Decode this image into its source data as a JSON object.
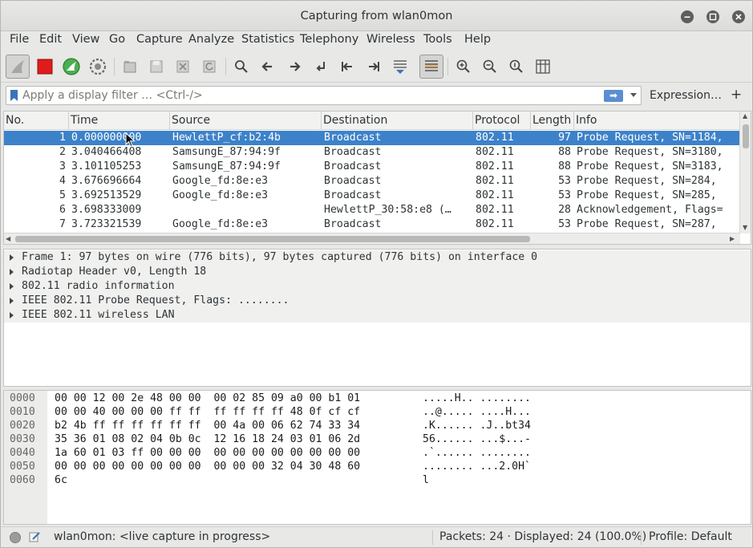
{
  "window": {
    "title": "Capturing from wlan0mon",
    "minimize_icon": "minimize-icon",
    "maximize_icon": "maximize-icon",
    "close_icon": "close-icon"
  },
  "menu": [
    "File",
    "Edit",
    "View",
    "Go",
    "Capture",
    "Analyze",
    "Statistics",
    "Telephony",
    "Wireless",
    "Tools",
    "Help"
  ],
  "toolbar": {
    "icons": [
      "shark-fin-start-icon",
      "stop-capture-icon",
      "restart-capture-icon",
      "capture-options-icon",
      "open-file-icon",
      "save-file-icon",
      "close-file-icon",
      "reload-file-icon",
      "find-packet-icon",
      "go-back-icon",
      "go-forward-icon",
      "go-to-packet-icon",
      "first-packet-icon",
      "last-packet-icon",
      "autoscroll-icon",
      "colorize-icon",
      "zoom-in-icon",
      "zoom-out-icon",
      "normal-size-icon",
      "resize-columns-icon"
    ]
  },
  "filter": {
    "placeholder": "Apply a display filter … <Ctrl-/>",
    "apply_arrow": "➡",
    "expression_label": "Expression…",
    "plus_label": "+"
  },
  "packet_list": {
    "columns": [
      "No.",
      "Time",
      "Source",
      "Destination",
      "Protocol",
      "Length",
      "Info"
    ],
    "rows": [
      {
        "no": "1",
        "time": "0.000000000",
        "source": "HewlettP_cf:b2:4b",
        "destination": "Broadcast",
        "protocol": "802.11",
        "length": "97",
        "info": "Probe Request, SN=1184,",
        "selected": true
      },
      {
        "no": "2",
        "time": "3.040466408",
        "source": "SamsungE_87:94:9f",
        "destination": "Broadcast",
        "protocol": "802.11",
        "length": "88",
        "info": "Probe Request, SN=3180,",
        "selected": false
      },
      {
        "no": "3",
        "time": "3.101105253",
        "source": "SamsungE_87:94:9f",
        "destination": "Broadcast",
        "protocol": "802.11",
        "length": "88",
        "info": "Probe Request, SN=3183,",
        "selected": false
      },
      {
        "no": "4",
        "time": "3.676696664",
        "source": "Google_fd:8e:e3",
        "destination": "Broadcast",
        "protocol": "802.11",
        "length": "53",
        "info": "Probe Request, SN=284,",
        "selected": false
      },
      {
        "no": "5",
        "time": "3.692513529",
        "source": "Google_fd:8e:e3",
        "destination": "Broadcast",
        "protocol": "802.11",
        "length": "53",
        "info": "Probe Request, SN=285,",
        "selected": false
      },
      {
        "no": "6",
        "time": "3.698333009",
        "source": "",
        "destination": "HewlettP_30:58:e8 (…",
        "protocol": "802.11",
        "length": "28",
        "info": "Acknowledgement, Flags=",
        "selected": false
      },
      {
        "no": "7",
        "time": "3.723321539",
        "source": "Google_fd:8e:e3",
        "destination": "Broadcast",
        "protocol": "802.11",
        "length": "53",
        "info": "Probe Request, SN=287,",
        "selected": false
      }
    ]
  },
  "details": [
    "Frame 1: 97 bytes on wire (776 bits), 97 bytes captured (776 bits) on interface 0",
    "Radiotap Header v0, Length 18",
    "802.11 radio information",
    "IEEE 802.11 Probe Request, Flags: ........",
    "IEEE 802.11 wireless LAN"
  ],
  "bytes": [
    {
      "offset": "0000",
      "hex": "00 00 12 00 2e 48 00 00  00 02 85 09 a0 00 b1 01",
      "ascii": ".....H.. ........"
    },
    {
      "offset": "0010",
      "hex": "00 00 40 00 00 00 ff ff  ff ff ff ff 48 0f cf cf",
      "ascii": "..@..... ....H..."
    },
    {
      "offset": "0020",
      "hex": "b2 4b ff ff ff ff ff ff  00 4a 00 06 62 74 33 34",
      "ascii": ".K...... .J..bt34"
    },
    {
      "offset": "0030",
      "hex": "35 36 01 08 02 04 0b 0c  12 16 18 24 03 01 06 2d",
      "ascii": "56...... ...$...-"
    },
    {
      "offset": "0040",
      "hex": "1a 60 01 03 ff 00 00 00  00 00 00 00 00 00 00 00",
      "ascii": ".`...... ........"
    },
    {
      "offset": "0050",
      "hex": "00 00 00 00 00 00 00 00  00 00 00 32 04 30 48 60",
      "ascii": "........ ...2.0H`"
    },
    {
      "offset": "0060",
      "hex": "6c",
      "ascii": "l"
    }
  ],
  "status": {
    "capture_text": "wlan0mon: <live capture in progress>",
    "packets_text": "Packets: 24 · Displayed: 24 (100.0%)",
    "profile_text": "Profile: Default"
  },
  "colors": {
    "selection": "#3d82c9",
    "stop_red": "#e01b1b",
    "restart_green": "#4caf50",
    "filter_bookmark": "#3b73b9"
  }
}
